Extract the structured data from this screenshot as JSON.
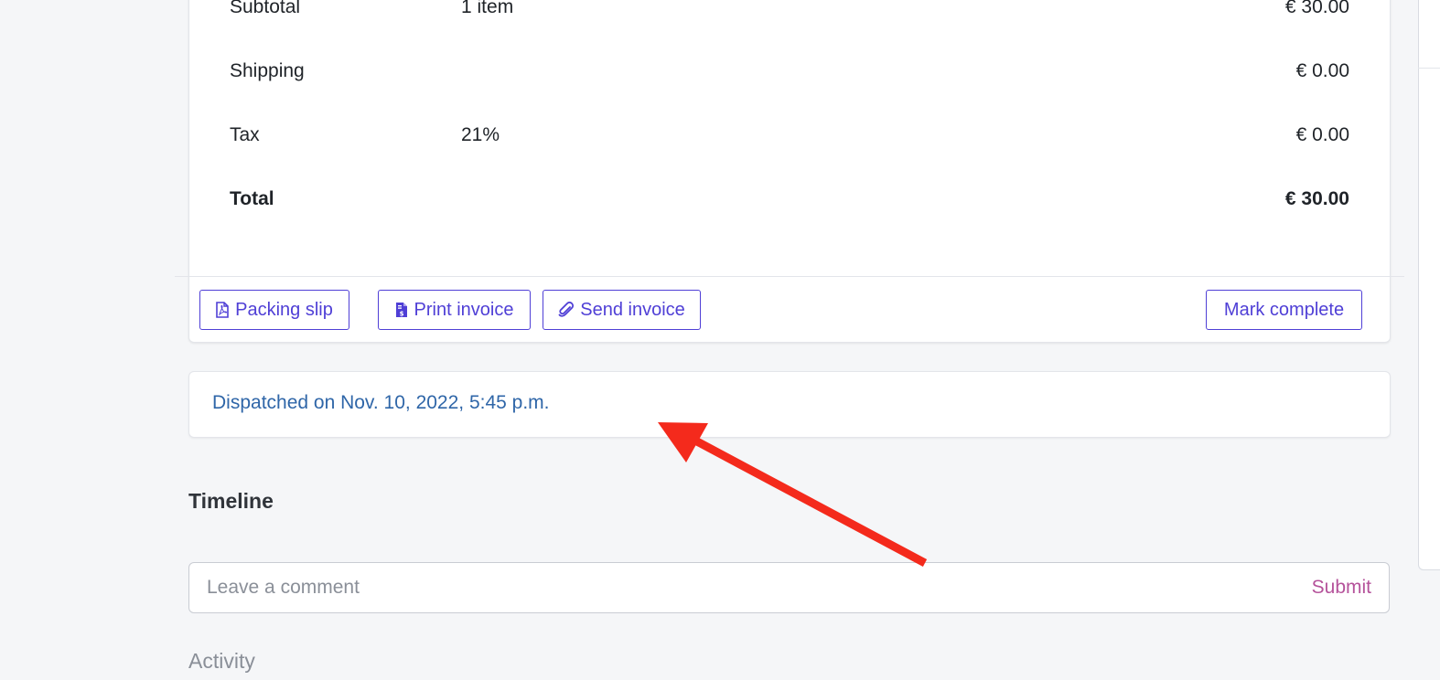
{
  "order_summary": {
    "subtotal": {
      "label": "Subtotal",
      "detail": "1 item",
      "amount": "€ 30.00"
    },
    "shipping": {
      "label": "Shipping",
      "detail": "",
      "amount": "€ 0.00"
    },
    "tax": {
      "label": "Tax",
      "detail": "21%",
      "amount": "€ 0.00"
    },
    "total": {
      "label": "Total",
      "amount": "€ 30.00"
    }
  },
  "actions": {
    "packing_slip": {
      "label": "Packing slip",
      "icon": "pdf-file-icon"
    },
    "print_invoice": {
      "label": "Print invoice",
      "icon": "invoice-file-icon"
    },
    "send_invoice": {
      "label": "Send invoice",
      "icon": "paperclip-icon"
    },
    "mark_complete": {
      "label": "Mark complete"
    }
  },
  "dispatch": {
    "text": "Dispatched on Nov. 10, 2022, 5:45 p.m."
  },
  "timeline": {
    "heading": "Timeline",
    "comment_placeholder": "Leave a comment",
    "submit_label": "Submit",
    "activity_heading": "Activity"
  },
  "colors": {
    "accent": "#4f3fd6",
    "dispatch_text": "#2f66a8",
    "submit": "#b5539b",
    "annotation_arrow": "#f42a1c",
    "page_background": "#f5f6f8"
  }
}
